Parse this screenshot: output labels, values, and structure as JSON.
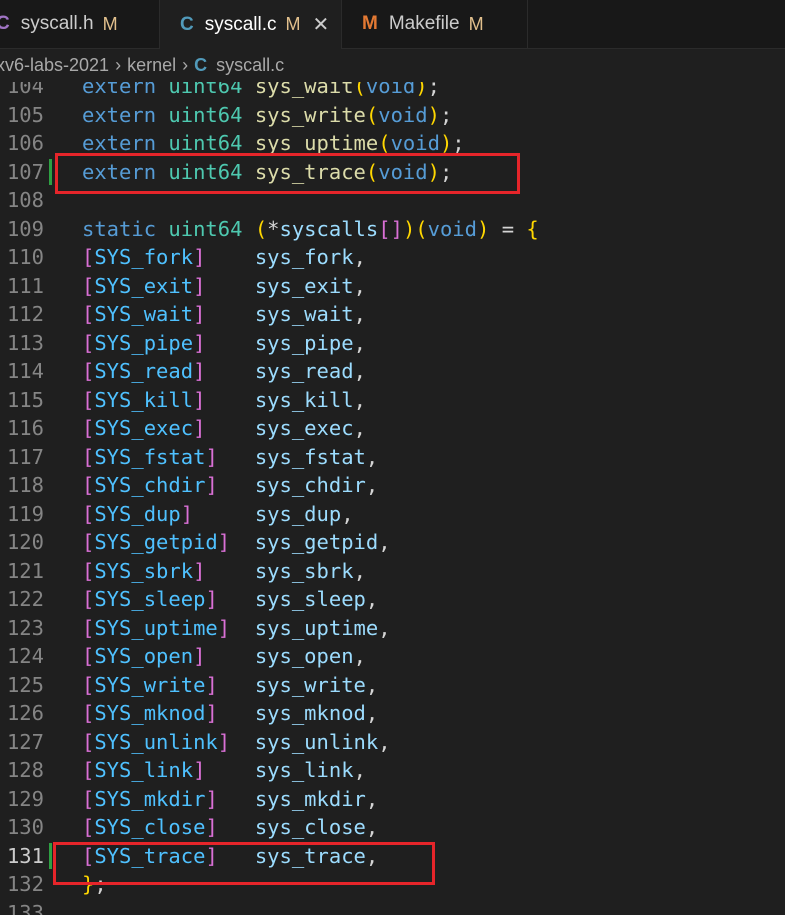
{
  "tabs": [
    {
      "icon": "C",
      "name": "syscall.h",
      "status": "M",
      "active": false
    },
    {
      "icon": "C",
      "name": "syscall.c",
      "status": "M",
      "active": true,
      "close": "✕"
    },
    {
      "icon": "M",
      "name": "Makefile",
      "status": "M",
      "active": false
    }
  ],
  "breadcrumb": {
    "root": "xv6-labs-2021",
    "folder": "kernel",
    "file_icon": "C",
    "file": "syscall.c",
    "separator": "›"
  },
  "colors": {
    "keyword": "#569cd6",
    "type": "#4ec9b0",
    "function": "#dcdcaa",
    "macro": "#4fc1ff",
    "bracket_gold": "#ffd700",
    "bracket_purple": "#da70d6",
    "annotation_red": "#e6252a",
    "added_line_green": "#2ea043"
  },
  "editor": {
    "current_line": 131,
    "lines": [
      {
        "n": "104",
        "code": "extern uint64 sys_wait(void);"
      },
      {
        "n": "105",
        "code": "extern uint64 sys_write(void);"
      },
      {
        "n": "106",
        "code": "extern uint64 sys_uptime(void);"
      },
      {
        "n": "107",
        "code": "extern uint64 sys_trace(void);",
        "added": true
      },
      {
        "n": "108",
        "code": ""
      },
      {
        "n": "109",
        "code": "static uint64 (*syscalls[])(void) = {"
      },
      {
        "n": "110",
        "code": "[SYS_fork]    sys_fork,"
      },
      {
        "n": "111",
        "code": "[SYS_exit]    sys_exit,"
      },
      {
        "n": "112",
        "code": "[SYS_wait]    sys_wait,"
      },
      {
        "n": "113",
        "code": "[SYS_pipe]    sys_pipe,"
      },
      {
        "n": "114",
        "code": "[SYS_read]    sys_read,"
      },
      {
        "n": "115",
        "code": "[SYS_kill]    sys_kill,"
      },
      {
        "n": "116",
        "code": "[SYS_exec]    sys_exec,"
      },
      {
        "n": "117",
        "code": "[SYS_fstat]   sys_fstat,"
      },
      {
        "n": "118",
        "code": "[SYS_chdir]   sys_chdir,"
      },
      {
        "n": "119",
        "code": "[SYS_dup]     sys_dup,"
      },
      {
        "n": "120",
        "code": "[SYS_getpid]  sys_getpid,"
      },
      {
        "n": "121",
        "code": "[SYS_sbrk]    sys_sbrk,"
      },
      {
        "n": "122",
        "code": "[SYS_sleep]   sys_sleep,"
      },
      {
        "n": "123",
        "code": "[SYS_uptime]  sys_uptime,"
      },
      {
        "n": "124",
        "code": "[SYS_open]    sys_open,"
      },
      {
        "n": "125",
        "code": "[SYS_write]   sys_write,"
      },
      {
        "n": "126",
        "code": "[SYS_mknod]   sys_mknod,"
      },
      {
        "n": "127",
        "code": "[SYS_unlink]  sys_unlink,"
      },
      {
        "n": "128",
        "code": "[SYS_link]    sys_link,"
      },
      {
        "n": "129",
        "code": "[SYS_mkdir]   sys_mkdir,"
      },
      {
        "n": "130",
        "code": "[SYS_close]   sys_close,"
      },
      {
        "n": "131",
        "code": "[SYS_trace]   sys_trace,",
        "added": true
      },
      {
        "n": "132",
        "code": "};"
      },
      {
        "n": "133",
        "code": ""
      }
    ]
  }
}
